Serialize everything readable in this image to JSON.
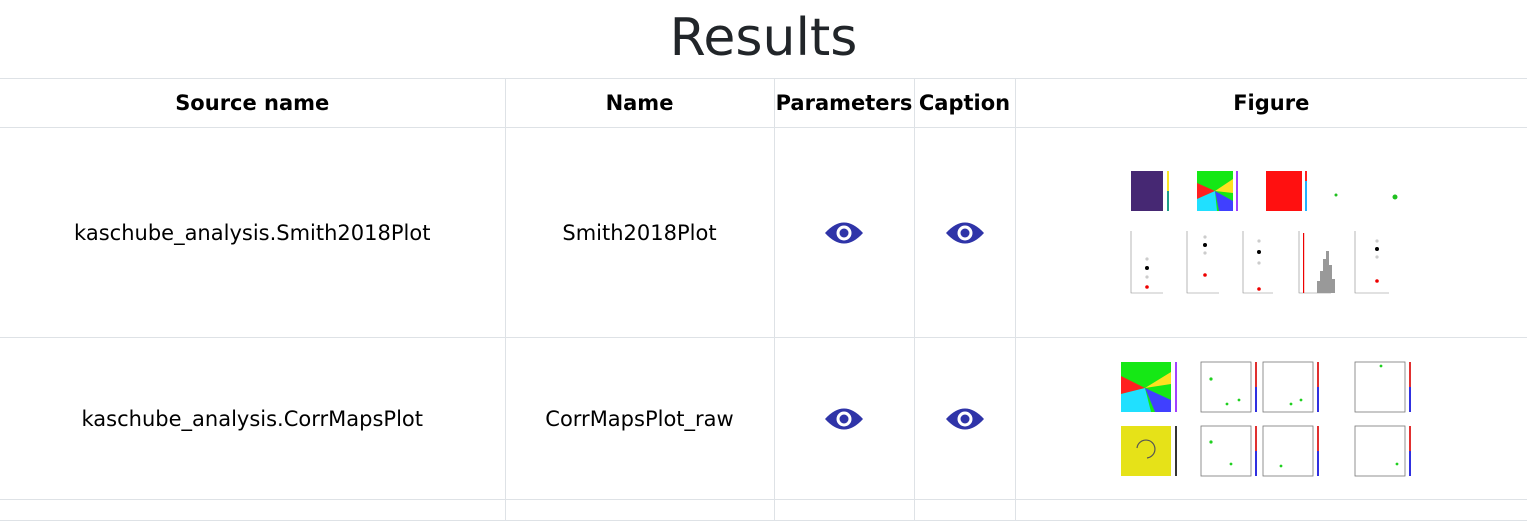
{
  "page": {
    "title": "Results"
  },
  "table": {
    "headers": [
      "Source name",
      "Name",
      "Parameters",
      "Caption",
      "Figure"
    ],
    "rows": [
      {
        "source_name": "kaschube_analysis.Smith2018Plot",
        "name": "Smith2018Plot",
        "parameters_icon": "eye-icon",
        "caption_icon": "eye-icon",
        "figure": "smith2018-figure-thumbnail"
      },
      {
        "source_name": "kaschube_analysis.CorrMapsPlot",
        "name": "CorrMapsPlot_raw",
        "parameters_icon": "eye-icon",
        "caption_icon": "eye-icon",
        "figure": "corrmaps-figure-thumbnail"
      }
    ]
  },
  "colors": {
    "eye_icon": "#2f34a8",
    "border": "#dee2e6",
    "text": "#212529"
  }
}
